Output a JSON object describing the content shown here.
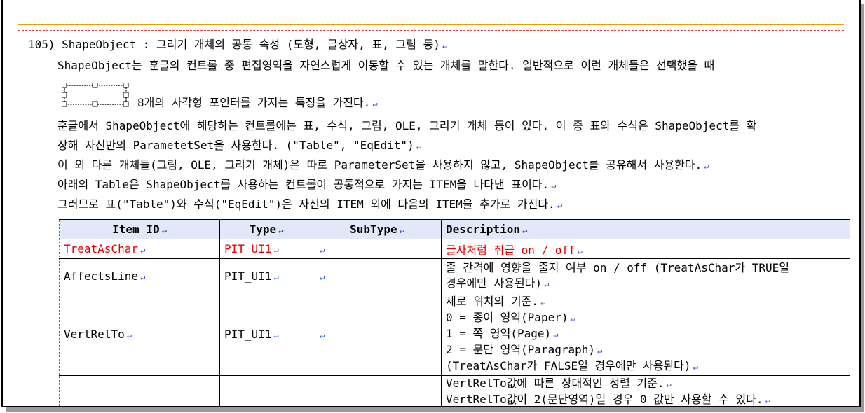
{
  "section": {
    "heading": "105) ShapeObject : 그리기 개체의 공통 속성 (도형, 글상자, 표, 그림 등)",
    "para1": "ShapeObject는 훈글의 컨트롤 중 편집영역을 자연스럽게 이동할 수 있는 개체를 말한다. 일반적으로 이런 개체들은 선택했을 때",
    "para1_cont": "8개의 사각형 포인터를 가지는 특징을 가진다.",
    "para2a": "훈글에서 ShapeObject에 해당하는 컨트롤에는 표, 수식, 그림, OLE, 그리기 개체 등이 있다. 이 중 표와 수식은 ShapeObject를 확",
    "para2b": "장해 자신만의 ParametetSet을 사용한다. (\"Table\", \"EqEdit\")",
    "para3": "이 외 다른 개체들(그림, OLE, 그리기 개체)은 따로 ParameterSet을 사용하지 않고, ShapeObject를 공유해서 사용한다.",
    "para4": "아래의 Table은  ShapeObject를 사용하는 컨트롤이 공통적으로 가지는 ITEM을 나타낸 표이다.",
    "para5": "그러므로 표(\"Table\")와 수식(\"EqEdit\")은 자신의 ITEM 외에 다음의 ITEM을 추가로 가진다.",
    "return_mark": "↵"
  },
  "table": {
    "headers": [
      "Item ID",
      "Type",
      "SubType",
      "Description"
    ],
    "rows": [
      {
        "item_id": "TreatAsChar",
        "type": "PIT_UI1",
        "subtype": "",
        "desc": [
          "글자처럼 취급 on / off"
        ]
      },
      {
        "item_id": "AffectsLine",
        "type": "PIT_UI1",
        "subtype": "",
        "desc": [
          "줄 간격에 영향을 줄지 여부 on / off (TreatAsChar가 TRUE일",
          "경우에만 사용된다)"
        ]
      },
      {
        "item_id": "VertRelTo",
        "type": "PIT_UI1",
        "subtype": "",
        "desc": [
          "세로 위치의 기준.",
          "0 = 종이 영역(Paper)",
          "1 = 쪽 영역(Page)",
          "2 = 문단 영역(Paragraph)",
          "(TreatAsChar가 FALSE일 경우에만 사용된다)"
        ]
      },
      {
        "item_id": "",
        "type": "",
        "subtype": "",
        "desc": [
          "VertRelTo값에 따른 상대적인 정렬 기준.",
          "VertRelTo값이 2(문단영역)일 경우 0 값만 사용할 수 있다."
        ]
      }
    ]
  },
  "colors": {
    "highlight_row": "#e00000",
    "header_bg": "#e3e8f8",
    "return_mark": "#3355cc"
  }
}
